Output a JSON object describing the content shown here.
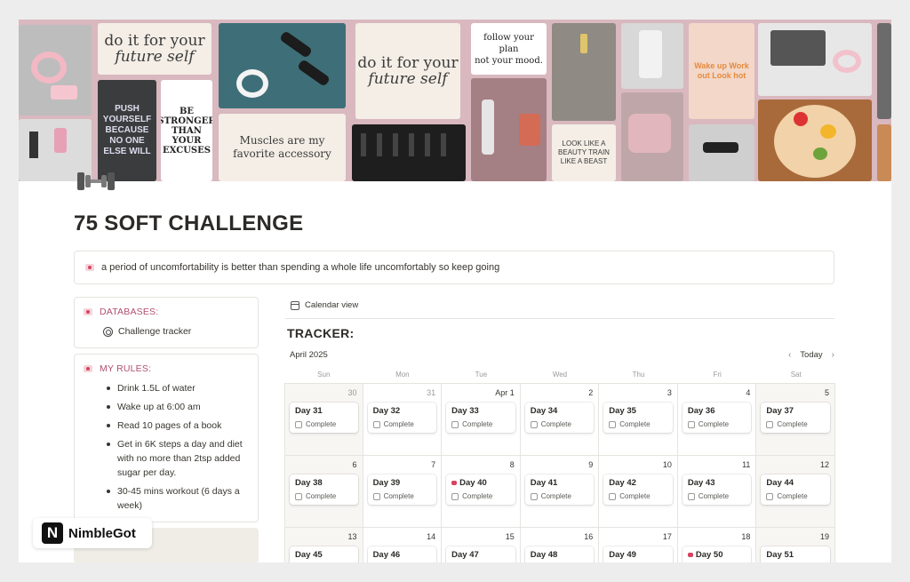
{
  "cover": {
    "quote1_a": "do it for your",
    "quote1_b": "future self",
    "quote2_a": "do it for your",
    "quote2_b": "future self",
    "poster_push": "PUSH YOURSELF BECAUSE NO ONE ELSE WILL",
    "poster_stronger": "BE STRONGER THAN YOUR EXCUSES",
    "muscles": "Muscles are my favorite accessory",
    "follow_plan_a": "follow your plan",
    "follow_plan_b": "not your mood.",
    "wake_up": "Wake up Work out Look hot",
    "beauty": "LOOK LIKE A BEAUTY TRAIN LIKE A BEAST"
  },
  "page": {
    "title": "75 SOFT CHALLENGE",
    "callout": "a period of uncomfortability is better than spending a whole life uncomfortably so keep going"
  },
  "sidebar": {
    "databases_heading": "DATABASES:",
    "databases_link": "Challenge tracker",
    "rules_heading": "MY RULES:",
    "rules": [
      "Drink 1.5L of water",
      "Wake up at 6:00 am",
      "Read 10 pages of a book",
      "Get in 6K steps a day and diet with no more than 2tsp added sugar per day.",
      "30-45 mins workout (6 days a week)"
    ]
  },
  "tracker": {
    "view_label": "Calendar view",
    "heading": "TRACKER:",
    "month": "April 2025",
    "today_label": "Today",
    "weekdays": [
      "Sun",
      "Mon",
      "Tue",
      "Wed",
      "Thu",
      "Fri",
      "Sat"
    ],
    "checkbox_label": "Complete",
    "weeks": [
      [
        {
          "date": "30",
          "muted": true,
          "entry": "Day 31"
        },
        {
          "date": "31",
          "muted": true,
          "entry": "Day 32"
        },
        {
          "date": "Apr 1",
          "entry": "Day 33"
        },
        {
          "date": "2",
          "entry": "Day 34"
        },
        {
          "date": "3",
          "entry": "Day 35"
        },
        {
          "date": "4",
          "entry": "Day 36"
        },
        {
          "date": "5",
          "entry": "Day 37"
        }
      ],
      [
        {
          "date": "6",
          "entry": "Day 38"
        },
        {
          "date": "7",
          "entry": "Day 39"
        },
        {
          "date": "8",
          "entry": "Day 40",
          "heart": true
        },
        {
          "date": "9",
          "entry": "Day 41"
        },
        {
          "date": "10",
          "entry": "Day 42"
        },
        {
          "date": "11",
          "entry": "Day 43"
        },
        {
          "date": "12",
          "entry": "Day 44"
        }
      ],
      [
        {
          "date": "13",
          "entry": "Day 45"
        },
        {
          "date": "14",
          "entry": "Day 46"
        },
        {
          "date": "15",
          "entry": "Day 47"
        },
        {
          "date": "16",
          "entry": "Day 48"
        },
        {
          "date": "17",
          "entry": "Day 49"
        },
        {
          "date": "18",
          "entry": "Day 50",
          "heart": true
        },
        {
          "date": "19",
          "entry": "Day 51"
        }
      ]
    ]
  },
  "brand": {
    "logo_letter": "N",
    "name": "NimbleGot"
  }
}
